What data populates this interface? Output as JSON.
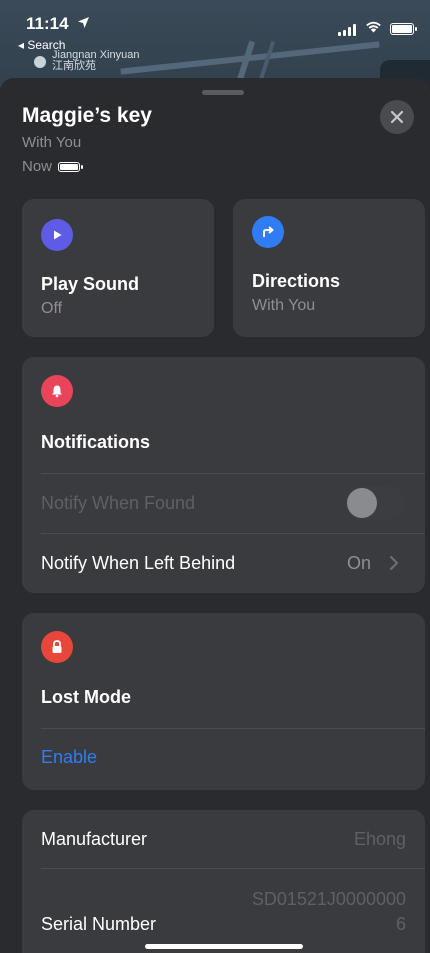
{
  "status_bar": {
    "time": "11:14",
    "location_arrow": "location-arrow-icon",
    "back_label": "◂ Search"
  },
  "map": {
    "label_line1": "Jiangnan Xinyuan",
    "label_line2": "江南欣苑"
  },
  "item": {
    "name": "Maggie’s key",
    "status": "With You",
    "last_seen": "Now"
  },
  "cards": {
    "play_sound": {
      "title": "Play Sound",
      "sub": "Off",
      "color": "#5e5ce6"
    },
    "directions": {
      "title": "Directions",
      "sub": "With You",
      "color": "#2f7cf6"
    }
  },
  "notifications": {
    "title": "Notifications",
    "color": "#e8445a",
    "notify_found": "Notify When Found",
    "notify_found_on": false,
    "notify_left_behind": "Notify When Left Behind",
    "notify_left_behind_value": "On"
  },
  "lost_mode": {
    "title": "Lost Mode",
    "color": "#e8463a",
    "action": "Enable",
    "action_color": "#2f7cf6"
  },
  "info": {
    "manufacturer_label": "Manufacturer",
    "manufacturer_value": "Ehong",
    "serial_label": "Serial Number",
    "serial_value_line1": "SD01521J0000000",
    "serial_value_line2": "6"
  }
}
